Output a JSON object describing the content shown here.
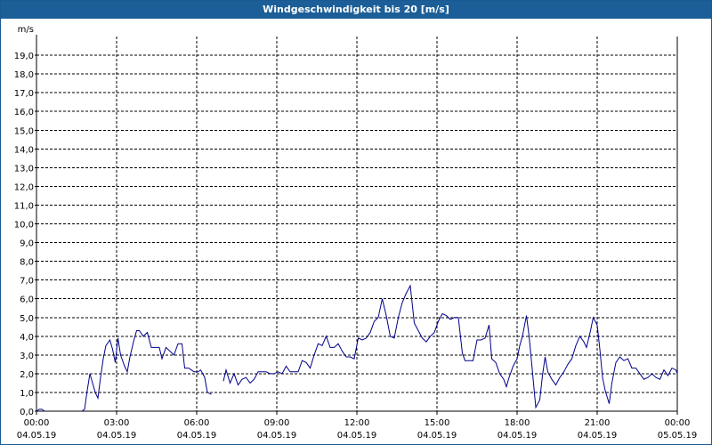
{
  "window": {
    "title": "Windgeschwindigkeit bis 20 [m/s]"
  },
  "colors": {
    "titlebar": "#1c5f98",
    "line": "#00008b",
    "grid": "#000000"
  },
  "chart_data": {
    "type": "line",
    "title": "Windgeschwindigkeit bis 20 [m/s]",
    "ylabel": "m/s",
    "xlabel": "",
    "ylim": [
      0,
      20
    ],
    "xlim_hours": [
      0,
      24
    ],
    "grid": true,
    "y_ticks": [
      "0,0",
      "1,0",
      "2,0",
      "3,0",
      "4,0",
      "5,0",
      "6,0",
      "7,0",
      "8,0",
      "9,0",
      "10,0",
      "11,0",
      "12,0",
      "13,0",
      "14,0",
      "15,0",
      "16,0",
      "17,0",
      "18,0",
      "19,0"
    ],
    "x_ticks": [
      {
        "time": "00:00",
        "date": "04.05.19"
      },
      {
        "time": "03:00",
        "date": "04.05.19"
      },
      {
        "time": "06:00",
        "date": "04.05.19"
      },
      {
        "time": "09:00",
        "date": "04.05.19"
      },
      {
        "time": "12:00",
        "date": "04.05.19"
      },
      {
        "time": "15:00",
        "date": "04.05.19"
      },
      {
        "time": "18:00",
        "date": "04.05.19"
      },
      {
        "time": "21:00",
        "date": "04.05.19"
      },
      {
        "time": "00:00",
        "date": "05.05.19"
      }
    ],
    "series": [
      {
        "segments": [
          [
            [
              0.0,
              0.0
            ],
            [
              0.1,
              0.1
            ],
            [
              0.2,
              0.1
            ],
            [
              0.3,
              0.0
            ]
          ],
          [
            [
              1.7,
              0.0
            ],
            [
              1.8,
              0.1
            ],
            [
              1.9,
              1.1
            ],
            [
              2.0,
              2.0
            ],
            [
              2.1,
              1.5
            ],
            [
              2.2,
              1.0
            ],
            [
              2.3,
              0.7
            ],
            [
              2.4,
              1.8
            ],
            [
              2.5,
              2.8
            ],
            [
              2.6,
              3.5
            ],
            [
              2.75,
              3.8
            ],
            [
              2.85,
              3.3
            ],
            [
              2.95,
              2.6
            ],
            [
              3.05,
              3.9
            ],
            [
              3.15,
              3.0
            ],
            [
              3.3,
              2.4
            ],
            [
              3.4,
              2.1
            ],
            [
              3.5,
              2.9
            ],
            [
              3.65,
              3.8
            ],
            [
              3.75,
              4.3
            ],
            [
              3.85,
              4.3
            ],
            [
              4.0,
              4.0
            ],
            [
              4.15,
              4.2
            ],
            [
              4.3,
              3.4
            ],
            [
              4.45,
              3.4
            ],
            [
              4.6,
              3.4
            ],
            [
              4.7,
              2.8
            ],
            [
              4.85,
              3.4
            ],
            [
              5.0,
              3.2
            ],
            [
              5.15,
              3.0
            ],
            [
              5.3,
              3.6
            ],
            [
              5.45,
              3.6
            ],
            [
              5.55,
              2.3
            ],
            [
              5.7,
              2.3
            ],
            [
              5.8,
              2.2
            ],
            [
              5.9,
              2.1
            ],
            [
              6.05,
              2.1
            ],
            [
              6.15,
              2.2
            ],
            [
              6.3,
              1.8
            ],
            [
              6.4,
              1.0
            ],
            [
              6.55,
              0.9
            ]
          ],
          [
            [
              7.0,
              1.6
            ],
            [
              7.1,
              2.2
            ],
            [
              7.25,
              1.5
            ],
            [
              7.4,
              2.0
            ],
            [
              7.55,
              1.4
            ],
            [
              7.7,
              1.7
            ],
            [
              7.85,
              1.8
            ],
            [
              8.0,
              1.5
            ],
            [
              8.15,
              1.7
            ],
            [
              8.3,
              2.1
            ],
            [
              8.45,
              2.1
            ],
            [
              8.6,
              2.1
            ],
            [
              8.75,
              2.0
            ],
            [
              8.9,
              2.0
            ],
            [
              9.05,
              2.1
            ],
            [
              9.2,
              2.0
            ],
            [
              9.35,
              2.4
            ],
            [
              9.5,
              2.1
            ],
            [
              9.65,
              2.1
            ],
            [
              9.8,
              2.1
            ],
            [
              9.95,
              2.7
            ],
            [
              10.1,
              2.6
            ],
            [
              10.25,
              2.3
            ],
            [
              10.4,
              3.0
            ],
            [
              10.55,
              3.6
            ],
            [
              10.7,
              3.5
            ],
            [
              10.85,
              4.0
            ],
            [
              11.0,
              3.4
            ],
            [
              11.15,
              3.4
            ],
            [
              11.3,
              3.6
            ],
            [
              11.45,
              3.2
            ],
            [
              11.6,
              2.9
            ],
            [
              11.75,
              2.9
            ],
            [
              11.9,
              2.8
            ],
            [
              12.05,
              3.9
            ],
            [
              12.2,
              3.8
            ],
            [
              12.35,
              3.9
            ],
            [
              12.5,
              4.2
            ],
            [
              12.65,
              4.8
            ],
            [
              12.8,
              5.0
            ],
            [
              12.95,
              6.0
            ],
            [
              13.1,
              5.1
            ],
            [
              13.25,
              4.0
            ],
            [
              13.4,
              3.9
            ],
            [
              13.55,
              5.0
            ],
            [
              13.7,
              5.8
            ],
            [
              13.85,
              6.3
            ],
            [
              14.0,
              6.7
            ],
            [
              14.15,
              4.7
            ],
            [
              14.3,
              4.3
            ],
            [
              14.45,
              3.9
            ],
            [
              14.6,
              3.7
            ],
            [
              14.75,
              4.0
            ],
            [
              14.9,
              4.2
            ],
            [
              15.05,
              4.8
            ],
            [
              15.2,
              5.2
            ],
            [
              15.35,
              5.1
            ],
            [
              15.5,
              4.9
            ],
            [
              15.65,
              5.0
            ],
            [
              15.8,
              5.0
            ],
            [
              15.95,
              3.1
            ],
            [
              16.05,
              2.7
            ],
            [
              16.2,
              2.7
            ],
            [
              16.35,
              2.7
            ],
            [
              16.5,
              3.8
            ],
            [
              16.65,
              3.8
            ],
            [
              16.8,
              3.9
            ],
            [
              16.95,
              4.6
            ],
            [
              17.05,
              2.8
            ],
            [
              17.2,
              2.6
            ],
            [
              17.35,
              2.0
            ],
            [
              17.5,
              1.7
            ],
            [
              17.6,
              1.3
            ],
            [
              17.7,
              1.8
            ],
            [
              17.85,
              2.4
            ],
            [
              18.0,
              2.8
            ],
            [
              18.1,
              3.5
            ],
            [
              18.2,
              4.0
            ],
            [
              18.35,
              5.1
            ],
            [
              18.45,
              4.0
            ],
            [
              18.55,
              2.5
            ],
            [
              18.7,
              0.2
            ],
            [
              18.85,
              0.6
            ],
            [
              18.95,
              1.9
            ],
            [
              19.05,
              2.9
            ],
            [
              19.15,
              2.1
            ],
            [
              19.3,
              1.7
            ],
            [
              19.45,
              1.4
            ],
            [
              19.6,
              1.8
            ],
            [
              19.75,
              2.1
            ],
            [
              19.9,
              2.5
            ],
            [
              20.05,
              2.8
            ],
            [
              20.2,
              3.5
            ],
            [
              20.35,
              4.0
            ],
            [
              20.5,
              3.7
            ],
            [
              20.6,
              3.4
            ],
            [
              20.75,
              4.3
            ],
            [
              20.85,
              5.0
            ],
            [
              21.0,
              4.6
            ],
            [
              21.1,
              3.3
            ],
            [
              21.2,
              1.8
            ],
            [
              21.3,
              1.1
            ],
            [
              21.45,
              0.4
            ],
            [
              21.55,
              1.5
            ],
            [
              21.7,
              2.6
            ],
            [
              21.85,
              2.9
            ],
            [
              22.0,
              2.7
            ],
            [
              22.15,
              2.8
            ],
            [
              22.3,
              2.3
            ],
            [
              22.45,
              2.3
            ],
            [
              22.6,
              2.0
            ],
            [
              22.75,
              1.7
            ],
            [
              22.9,
              1.8
            ],
            [
              23.05,
              2.0
            ],
            [
              23.2,
              1.8
            ],
            [
              23.35,
              1.7
            ],
            [
              23.5,
              2.2
            ],
            [
              23.65,
              1.9
            ],
            [
              23.8,
              2.3
            ],
            [
              23.95,
              2.2
            ],
            [
              24.0,
              2.0
            ]
          ]
        ]
      }
    ]
  }
}
